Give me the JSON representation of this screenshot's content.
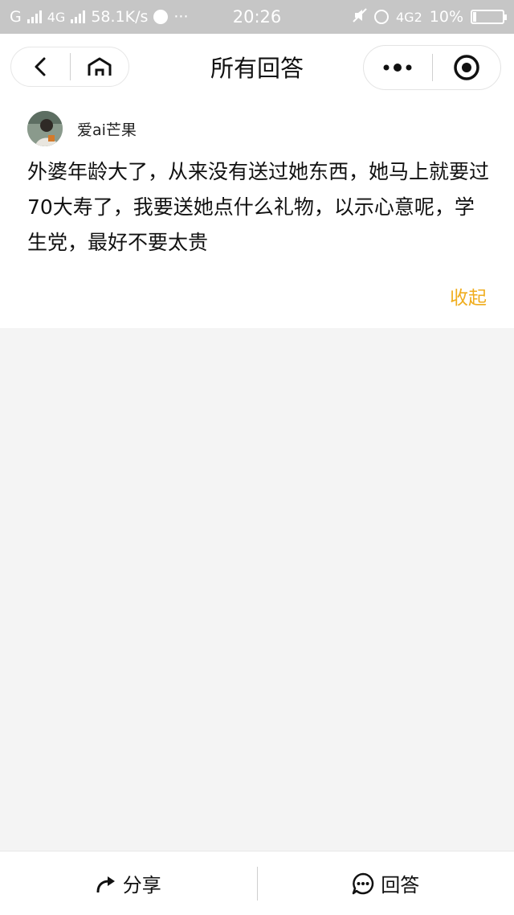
{
  "status_bar": {
    "carrier_g": "G",
    "network_4g": "4G",
    "speed": "58.1K/s",
    "more": "···",
    "time": "20:26",
    "network_4g2": "4G2",
    "battery": "10%"
  },
  "header": {
    "title": "所有回答"
  },
  "question": {
    "username": "爱ai芒果",
    "text": "外婆年龄大了，从来没有送过她东西，她马上就要过70大寿了，我要送她点什么礼物，以示心意呢，学生党，最好不要太贵",
    "collapse_label": "收起"
  },
  "bottom_bar": {
    "share_label": "分享",
    "answer_label": "回答"
  },
  "colors": {
    "accent": "#f0ad1e",
    "status_bar_bg": "#c6c6c6",
    "page_bg": "#f4f4f4"
  },
  "icons": {
    "back": "back-arrow-icon",
    "home": "home-icon",
    "more": "more-dots-icon",
    "close": "target-circle-icon",
    "share": "share-arrow-icon",
    "answer": "chat-bubble-icon"
  }
}
